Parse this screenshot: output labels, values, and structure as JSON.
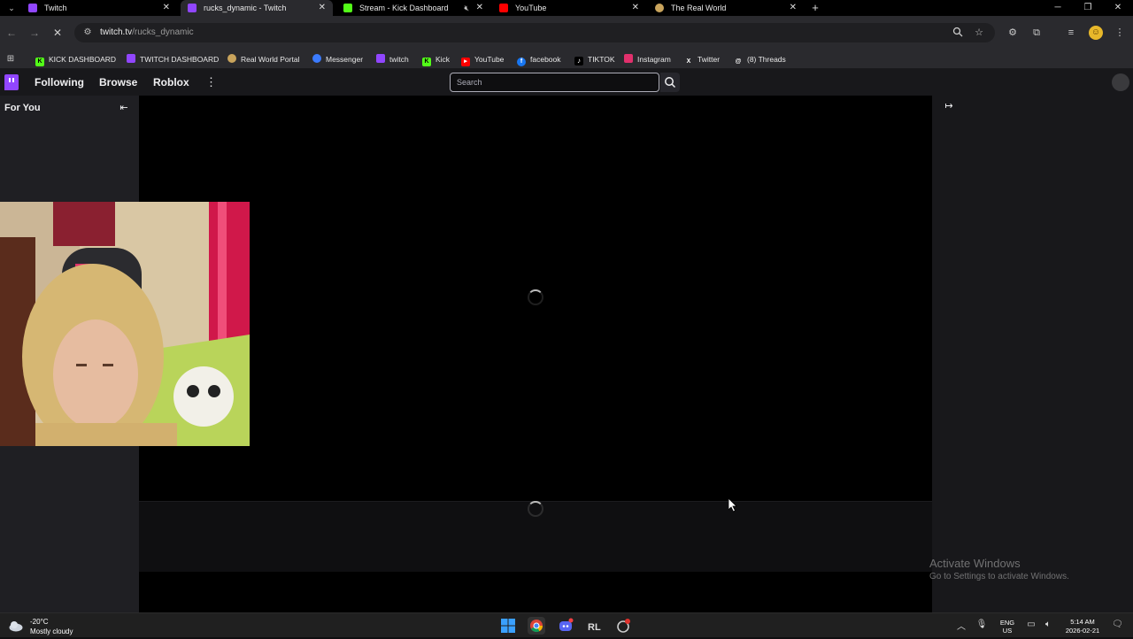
{
  "browser": {
    "tabs": [
      {
        "title": "Twitch",
        "favicon": "twitch-icon",
        "color": "#9146ff"
      },
      {
        "title": "rucks_dynamic - Twitch",
        "favicon": "twitch-icon",
        "color": "#9146ff",
        "active": true
      },
      {
        "title": "Stream - Kick Dashboard",
        "favicon": "kick-icon",
        "color": "#53fc18",
        "muted": true
      },
      {
        "title": "YouTube",
        "favicon": "youtube-icon",
        "color": "#ff0000"
      },
      {
        "title": "The Real World",
        "favicon": "real-world-icon",
        "color": "#c9a45c"
      }
    ],
    "url_host": "twitch.tv",
    "url_path": "/rucks_dynamic",
    "bookmarks": [
      {
        "label": "KICK DASHBOARD",
        "icon": "kick-icon"
      },
      {
        "label": "TWITCH DASHBOARD",
        "icon": "twitch-icon"
      },
      {
        "label": "Real World Portal",
        "icon": "real-world-icon"
      },
      {
        "label": "Messenger",
        "icon": "messenger-icon"
      },
      {
        "label": "twitch",
        "icon": "twitch-icon"
      },
      {
        "label": "Kick",
        "icon": "kick-icon"
      },
      {
        "label": "YouTube",
        "icon": "youtube-icon"
      },
      {
        "label": "facebook",
        "icon": "facebook-icon"
      },
      {
        "label": "TIKTOK",
        "icon": "tiktok-icon"
      },
      {
        "label": "Instagram",
        "icon": "instagram-icon"
      },
      {
        "label": "Twitter",
        "icon": "x-icon"
      },
      {
        "label": "(8) Threads",
        "icon": "threads-icon"
      }
    ]
  },
  "twitch": {
    "nav": {
      "following": "Following",
      "browse": "Browse",
      "game": "Roblox"
    },
    "search_placeholder": "Search",
    "sidebar_heading": "For You",
    "brand_color": "#9146ff"
  },
  "watermark": {
    "line1": "Activate Windows",
    "line2": "Go to Settings to activate Windows."
  },
  "taskbar": {
    "temperature": "-20°C",
    "weather": "Mostly cloudy",
    "lang1": "ENG",
    "lang2": "US",
    "time": "5:14 AM",
    "date": "2026-02-21"
  }
}
